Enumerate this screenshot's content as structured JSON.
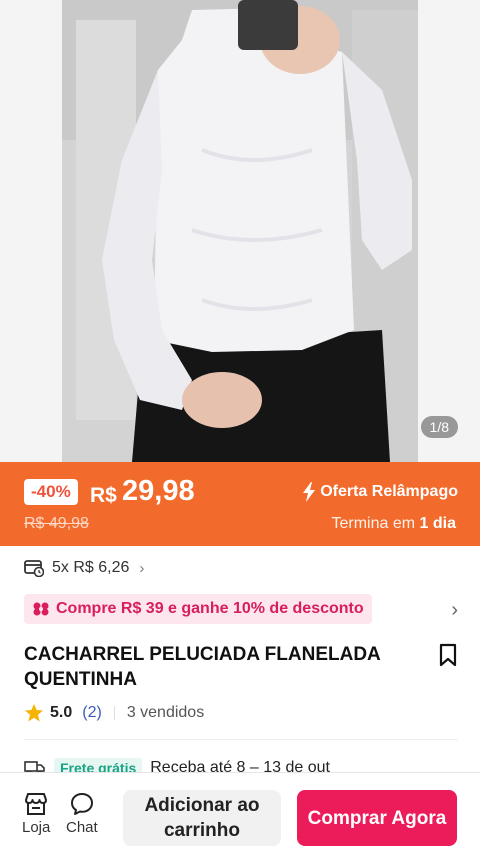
{
  "gallery": {
    "counter": "1/8"
  },
  "deal": {
    "discount": "-40%",
    "currency": "R$",
    "price": "29,98",
    "old_price": "R$ 49,98",
    "flash_label": "Oferta Relâmpago",
    "ends_prefix": "Termina em",
    "ends_value": "1 dia",
    "band_color": "#f26b2c"
  },
  "installment": {
    "text": "5x R$ 6,26",
    "icon": "card-clock-icon"
  },
  "promo": {
    "text": "Compre R$ 39 e ganhe 10% de desconto",
    "color": "#d81e5b"
  },
  "product": {
    "title": "CACHARREL PELUCIADA FLANELADA QUENTINHA"
  },
  "rating": {
    "score": "5.0",
    "count": "(2)",
    "sold": "3 vendidos"
  },
  "shipping": {
    "badge": "Frete grátis",
    "text": "Receba até 8 – 13 de out"
  },
  "bottom_bar": {
    "store_label": "Loja",
    "chat_label": "Chat",
    "add_to_cart": "Adicionar ao carrinho",
    "buy_now": "Comprar Agora",
    "buy_color": "#ec1c5a"
  }
}
